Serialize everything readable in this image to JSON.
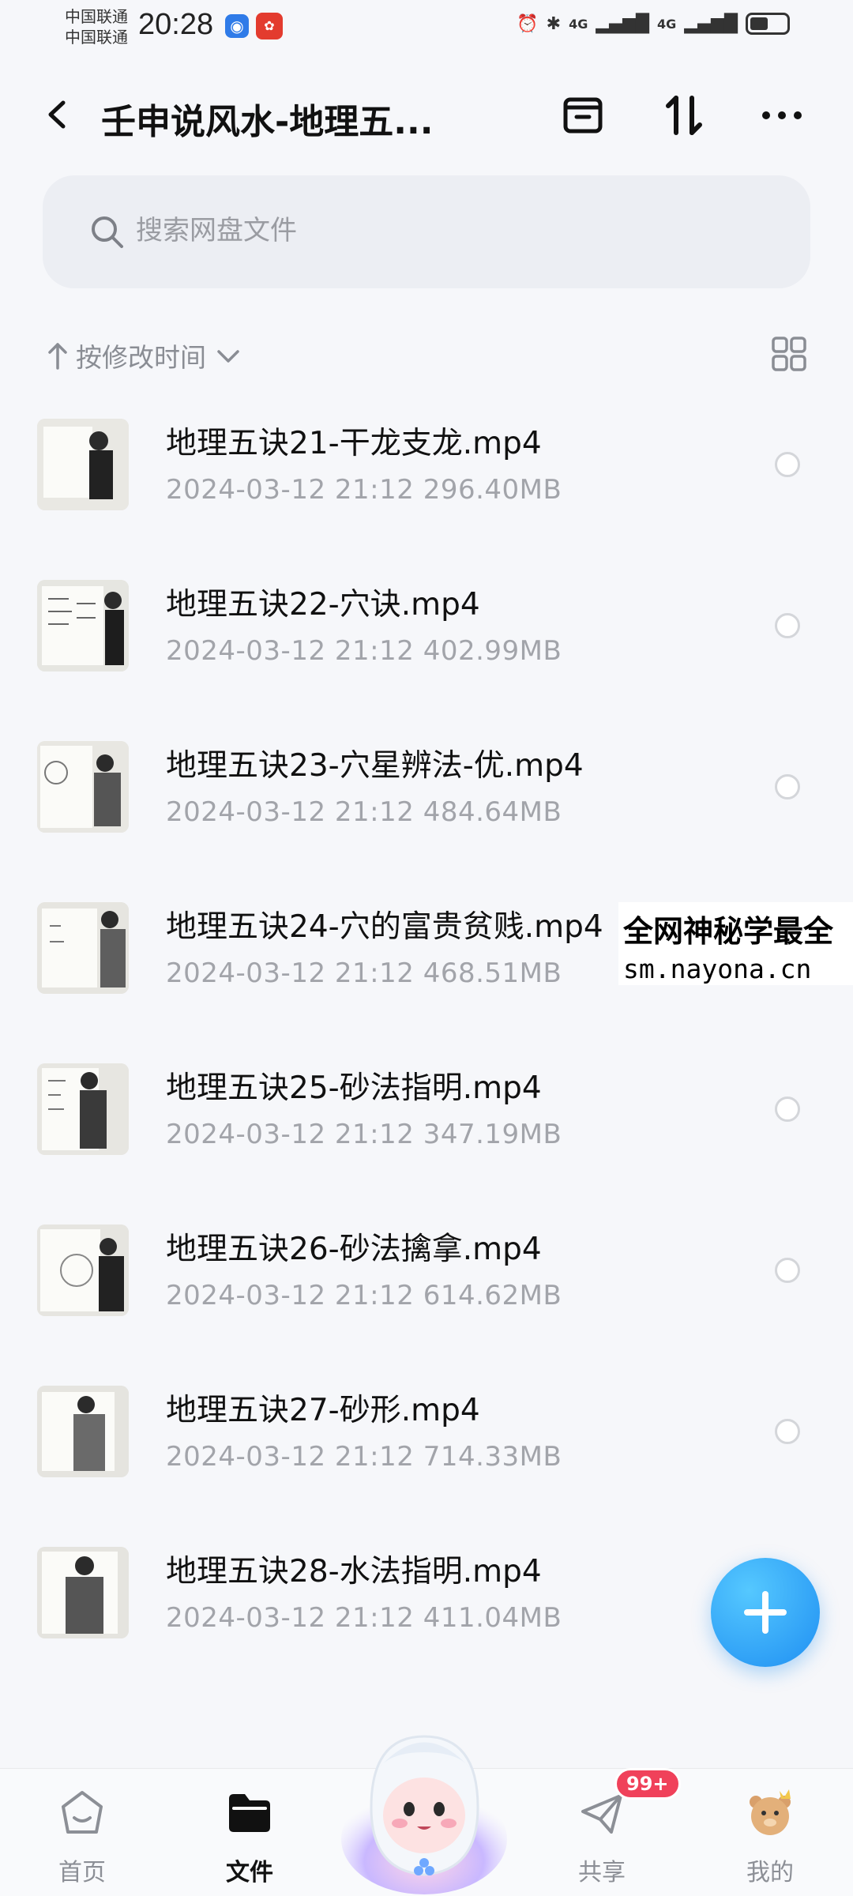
{
  "status_bar": {
    "carrier1": "中国联通",
    "carrier2": "中国联通",
    "time": "20:28",
    "signal1": "4G",
    "signal2": "4G"
  },
  "header": {
    "title": "壬申说风水-地理五..."
  },
  "search": {
    "placeholder": "搜索网盘文件"
  },
  "sort": {
    "label": "按修改时间"
  },
  "files": [
    {
      "name": "地理五诀21-干龙支龙.mp4",
      "date": "2024-03-12",
      "time": "21:12",
      "size": "296.40MB"
    },
    {
      "name": "地理五诀22-穴诀.mp4",
      "date": "2024-03-12",
      "time": "21:12",
      "size": "402.99MB"
    },
    {
      "name": "地理五诀23-穴星辨法-优.mp4",
      "date": "2024-03-12",
      "time": "21:12",
      "size": "484.64MB"
    },
    {
      "name": "地理五诀24-穴的富贵贫贱.mp4",
      "date": "2024-03-12",
      "time": "21:12",
      "size": "468.51MB"
    },
    {
      "name": "地理五诀25-砂法指明.mp4",
      "date": "2024-03-12",
      "time": "21:12",
      "size": "347.19MB"
    },
    {
      "name": "地理五诀26-砂法擒拿.mp4",
      "date": "2024-03-12",
      "time": "21:12",
      "size": "614.62MB"
    },
    {
      "name": "地理五诀27-砂形.mp4",
      "date": "2024-03-12",
      "time": "21:12",
      "size": "714.33MB"
    },
    {
      "name": "地理五诀28-水法指明.mp4",
      "date": "2024-03-12",
      "time": "21:12",
      "size": "411.04MB"
    }
  ],
  "watermark": {
    "line1": "全网神秘学最全",
    "line2": "sm.nayona.cn"
  },
  "nav": {
    "home": "首页",
    "files": "文件",
    "share": "共享",
    "mine": "我的",
    "share_badge": "99+"
  },
  "colors": {
    "accent": "#1f8ff2",
    "badge": "#f0415a",
    "background": "#f6f7fa"
  }
}
